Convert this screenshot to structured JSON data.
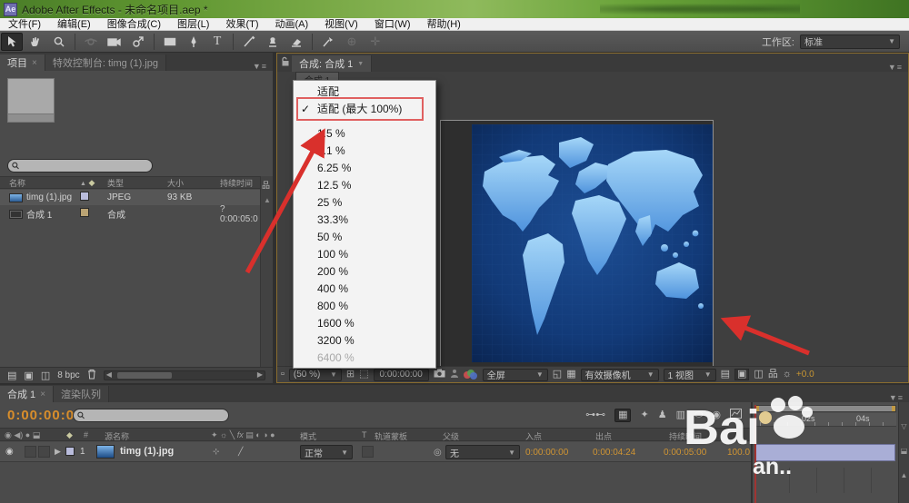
{
  "window": {
    "title": "Adobe After Effects - 未命名项目.aep *",
    "app_icon": "Ae"
  },
  "menu_bar": [
    "文件(F)",
    "编辑(E)",
    "图像合成(C)",
    "图层(L)",
    "效果(T)",
    "动画(A)",
    "视图(V)",
    "窗口(W)",
    "帮助(H)"
  ],
  "toolbar": {
    "workspace_label": "工作区:",
    "workspace_value": "标准",
    "text_tool": "T"
  },
  "project_panel": {
    "tab_project": "项目",
    "tab_effects": "特效控制台: timg (1).jpg",
    "columns": {
      "name": "名称",
      "type": "类型",
      "size": "大小",
      "duration": "持续时间"
    },
    "rows": [
      {
        "name": "timg (1).jpg",
        "type": "JPEG",
        "size": "93 KB",
        "duration": ""
      },
      {
        "name": "合成 1",
        "type": "合成",
        "size": "",
        "duration": "? 0:00:05:0"
      }
    ],
    "bpc": "8 bpc"
  },
  "viewer": {
    "tab": "合成: 合成 1",
    "comp_tab": "合成 1",
    "zoom": "(50 %)",
    "timecode": "0:00:00:00",
    "resolution": "全屏",
    "camera": "有效摄像机",
    "view": "1 视图",
    "exposure": "+0.0"
  },
  "zoom_menu": {
    "items": [
      {
        "label": "适配"
      },
      {
        "label": "适配 (最大 100%)"
      },
      {
        "label": "1.5 %"
      },
      {
        "label": "3.1 %"
      },
      {
        "label": "6.25 %"
      },
      {
        "label": "12.5 %"
      },
      {
        "label": "25 %"
      },
      {
        "label": "33.3%"
      },
      {
        "label": "50 %"
      },
      {
        "label": "100 %"
      },
      {
        "label": "200 %"
      },
      {
        "label": "400 %"
      },
      {
        "label": "800 %"
      },
      {
        "label": "1600 %"
      },
      {
        "label": "3200 %"
      },
      {
        "label": "6400 %"
      }
    ]
  },
  "timeline": {
    "tab_comp": "合成 1",
    "tab_render": "渲染队列",
    "timecode": "0:00:00:00",
    "columns": {
      "source_name": "源名称",
      "mode": "模式",
      "trkmat_t": "T",
      "trkmat": "轨道蒙板",
      "parent": "父级",
      "in": "入点",
      "out": "出点",
      "duration": "持续时间"
    },
    "layer": {
      "index": "1",
      "name": "timg (1).jpg",
      "mode": "正常",
      "parent": "无",
      "in": "0:00:00:00",
      "out": "0:00:04:24",
      "duration": "0:00:05:00",
      "stretch": "100.0"
    },
    "ruler": {
      "t2": "02s",
      "t4": "04s"
    }
  },
  "watermark": {
    "brand": "Bai",
    "suffix": "an.."
  },
  "icons": {
    "close": "×",
    "caret": "▼",
    "menu": "▼≡",
    "check": "✓",
    "fx": "fx",
    "hash": "#",
    "sort": "▲",
    "up": "▲",
    "left": "◀",
    "right": "▶",
    "expand": "▶",
    "net": "品",
    "pin": "◎",
    "sun": "☼"
  },
  "colors": {
    "accent_orange": "#cf9433",
    "annotation_red": "#d9302c",
    "label_lavender": "#b9bcdc",
    "label_tan": "#bba474",
    "map_bg": "#123a78",
    "map_land": "#8ec9f5"
  }
}
